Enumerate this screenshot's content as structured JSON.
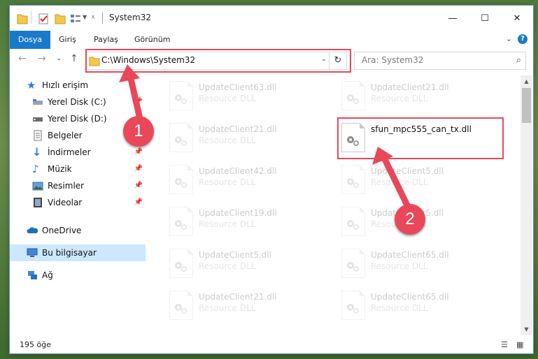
{
  "window": {
    "title": "System32",
    "controls": {
      "minimize": "—",
      "maximize": "☐",
      "close": "✕"
    }
  },
  "ribbon": {
    "tabs": [
      "Dosya",
      "Giriş",
      "Paylaş",
      "Görünüm"
    ],
    "expand": "⌄",
    "help": "?"
  },
  "navigation": {
    "back": "←",
    "forward": "→",
    "recent": "⌄",
    "up": "↑",
    "address": "C:\\Windows\\System32",
    "search_placeholder": "Ara: System32"
  },
  "sidebar": {
    "items": [
      {
        "label": "Hızlı erişim",
        "icon": "star-icon",
        "pinned": false
      },
      {
        "label": "Yerel Disk (C:)",
        "icon": "drive-icon",
        "pinned": true
      },
      {
        "label": "Yerel Disk (D:)",
        "icon": "drive-icon",
        "pinned": true
      },
      {
        "label": "Belgeler",
        "icon": "documents-icon",
        "pinned": true
      },
      {
        "label": "İndirmeler",
        "icon": "download-icon",
        "pinned": true
      },
      {
        "label": "Müzik",
        "icon": "music-icon",
        "pinned": true
      },
      {
        "label": "Resimler",
        "icon": "pictures-icon",
        "pinned": true
      },
      {
        "label": "Videolar",
        "icon": "videos-icon",
        "pinned": true
      },
      {
        "label": "OneDrive",
        "icon": "cloud-icon",
        "pinned": false
      },
      {
        "label": "Bu bilgisayar",
        "icon": "computer-icon",
        "pinned": false,
        "selected": true
      },
      {
        "label": "Ağ",
        "icon": "network-icon",
        "pinned": false
      }
    ]
  },
  "files": {
    "left": [
      {
        "name": "UpdateClient63.dll",
        "desc": "Resource DLL"
      },
      {
        "name": "UpdateClient21.dll",
        "desc": "Resource DLL"
      },
      {
        "name": "UpdateClient42.dll",
        "desc": "Resource DLL"
      },
      {
        "name": "UpdateClient19.dll",
        "desc": "Resource DLL"
      },
      {
        "name": "UpdateClient5.dll",
        "desc": "Resource DLL"
      },
      {
        "name": "UpdateClient21.dll",
        "desc": "Resource DLL"
      }
    ],
    "right": [
      {
        "name": "UpdateClient21.dll",
        "desc": "Resource DLL"
      },
      {
        "name": "sfun_mpc555_can_tx.dll",
        "desc": ""
      },
      {
        "name": "UpdateClient5.dll",
        "desc": "Resource DLL"
      },
      {
        "name": "UpdateClient5.dll",
        "desc": "Resource DLL"
      },
      {
        "name": "UpdateClient65.dll",
        "desc": "Resource DLL"
      },
      {
        "name": "UpdateClient65.dll",
        "desc": "Resource DLL"
      }
    ]
  },
  "status": {
    "count": "195 öğe"
  },
  "annotations": {
    "marker1": "1",
    "marker2": "2",
    "color": "#e8485a"
  }
}
